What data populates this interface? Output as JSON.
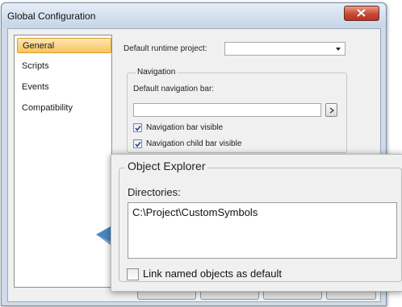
{
  "window": {
    "title": "Global Configuration"
  },
  "sidebar": {
    "items": [
      {
        "label": "General",
        "active": true
      },
      {
        "label": "Scripts",
        "active": false
      },
      {
        "label": "Events",
        "active": false
      },
      {
        "label": "Compatibility",
        "active": false
      }
    ]
  },
  "general": {
    "runtime_project_label": "Default runtime project:",
    "runtime_project_value": "",
    "navigation": {
      "group_label": "Navigation",
      "nav_bar_label": "Default navigation bar:",
      "nav_bar_value": "",
      "checkboxes": [
        {
          "label": "Navigation bar visible",
          "checked": true
        },
        {
          "label": "Navigation child bar visible",
          "checked": true
        }
      ]
    }
  },
  "object_explorer": {
    "group_label": "Object Explorer",
    "directories_label": "Directories:",
    "directories_value": "C:\\Project\\CustomSymbols",
    "link_named_label": "Link named objects as default",
    "link_named_checked": false
  },
  "colors": {
    "active_item": "#f9c45c",
    "pointer": "#4a86c5",
    "close_button": "#c74a35"
  },
  "icons": [
    "close-icon",
    "browse-icon",
    "checkmark-icon",
    "dropdown-arrow-icon",
    "pointer-arrow-icon"
  ]
}
